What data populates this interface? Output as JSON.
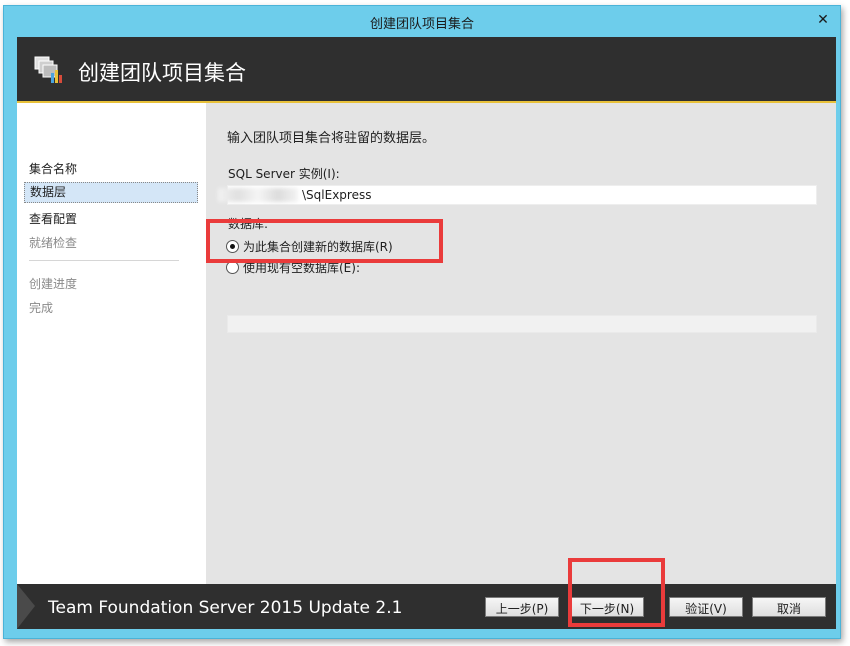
{
  "window": {
    "title": "创建团队项目集合",
    "close_label": "✕"
  },
  "header": {
    "title": "创建团队项目集合",
    "icon": "collection-icon"
  },
  "nav": {
    "items": [
      {
        "label": "集合名称",
        "state": "done"
      },
      {
        "label": "数据层",
        "state": "active"
      },
      {
        "label": "查看配置",
        "state": "done"
      },
      {
        "label": "就绪检查",
        "state": "disabled"
      },
      {
        "label": "创建进度",
        "state": "disabled"
      },
      {
        "label": "完成",
        "state": "disabled"
      }
    ]
  },
  "content": {
    "heading": "输入团队项目集合将驻留的数据层。",
    "sql_label": "SQL Server 实例(I):",
    "sql_value": "\\SqlExpress",
    "database_label": "数据库:",
    "radio_create": "为此集合创建新的数据库(R)",
    "radio_existing": "使用现有空数据库(E):"
  },
  "footer": {
    "product": "Team Foundation Server 2015 Update 2.1",
    "buttons": {
      "previous": "上一步(P)",
      "next": "下一步(N)",
      "verify": "验证(V)",
      "cancel": "取消"
    }
  },
  "colors": {
    "titlebar": "#6dcdeb",
    "header_bg": "#2f2f2f",
    "accent_line": "#e8c13a",
    "annotation_red": "#ea3b3b"
  }
}
